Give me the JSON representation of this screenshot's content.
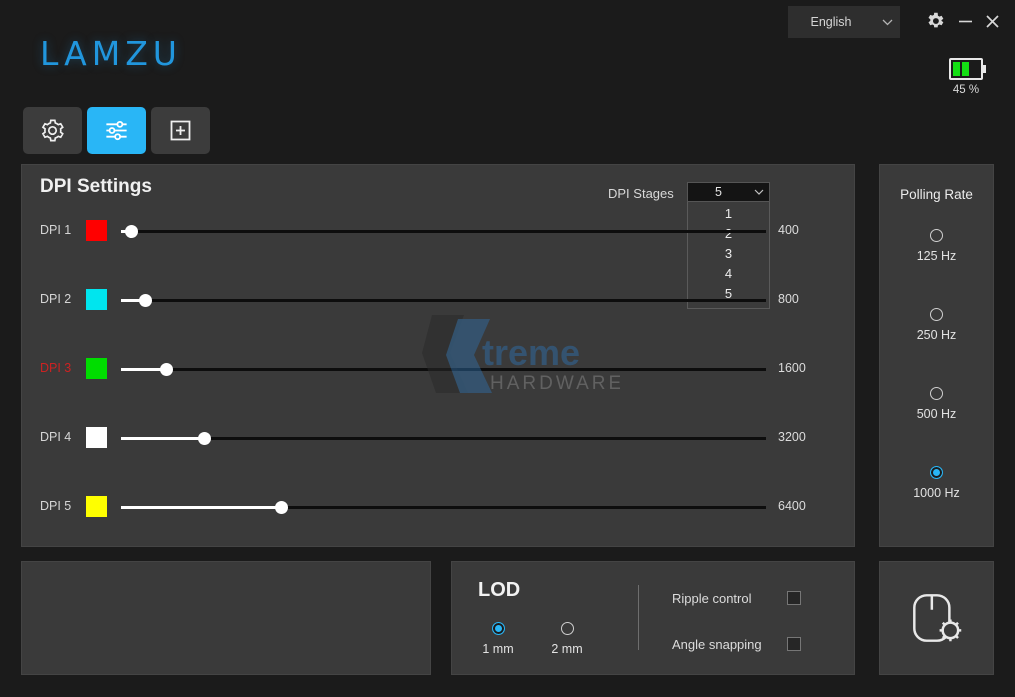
{
  "titlebar": {
    "language": "English",
    "icons": [
      "gear-icon",
      "minimize-icon",
      "close-icon"
    ]
  },
  "brand": {
    "logo_text": "LAMZU",
    "logo_color": "#2196dd"
  },
  "battery": {
    "percent_label": "45 %",
    "level": 45,
    "bar_color": "#14e014"
  },
  "tabs": [
    {
      "name": "general",
      "icon": "gear-icon",
      "active": false
    },
    {
      "name": "settings",
      "icon": "sliders-icon",
      "active": true
    },
    {
      "name": "add",
      "icon": "plus-square-icon",
      "active": false
    }
  ],
  "dpi_settings": {
    "title": "DPI Settings",
    "stages_label": "DPI Stages",
    "stages_value": "5",
    "stages_options": [
      "1",
      "2",
      "3",
      "4",
      "5"
    ],
    "stages_open": true,
    "rows": [
      {
        "label": "DPI 1",
        "color": "#ff0000",
        "value": "400",
        "pos": 1.6,
        "active": false
      },
      {
        "label": "DPI 2",
        "color": "#00e5ee",
        "value": "800",
        "pos": 3.7,
        "active": false
      },
      {
        "label": "DPI 3",
        "color": "#00dd00",
        "value": "1600",
        "pos": 7.0,
        "active": true
      },
      {
        "label": "DPI 4",
        "color": "#ffffff",
        "value": "3200",
        "pos": 12.9,
        "active": false
      },
      {
        "label": "DPI 5",
        "color": "#ffff00",
        "value": "6400",
        "pos": 24.8,
        "active": false
      }
    ]
  },
  "polling_rate": {
    "title": "Polling Rate",
    "options": [
      {
        "label": "125 Hz",
        "selected": false
      },
      {
        "label": "250 Hz",
        "selected": false
      },
      {
        "label": "500 Hz",
        "selected": false
      },
      {
        "label": "1000 Hz",
        "selected": true
      }
    ],
    "accent": "#29b6f6"
  },
  "lod": {
    "title": "LOD",
    "options": [
      {
        "label": "1 mm",
        "selected": true
      },
      {
        "label": "2 mm",
        "selected": false
      }
    ],
    "toggles": [
      {
        "label": "Ripple control",
        "checked": false
      },
      {
        "label": "Angle snapping",
        "checked": false
      }
    ]
  },
  "mouse_panel": {
    "icon": "mouse-gear-icon"
  },
  "watermark": {
    "line1": "Xtreme",
    "line2": "HARDWARE"
  }
}
